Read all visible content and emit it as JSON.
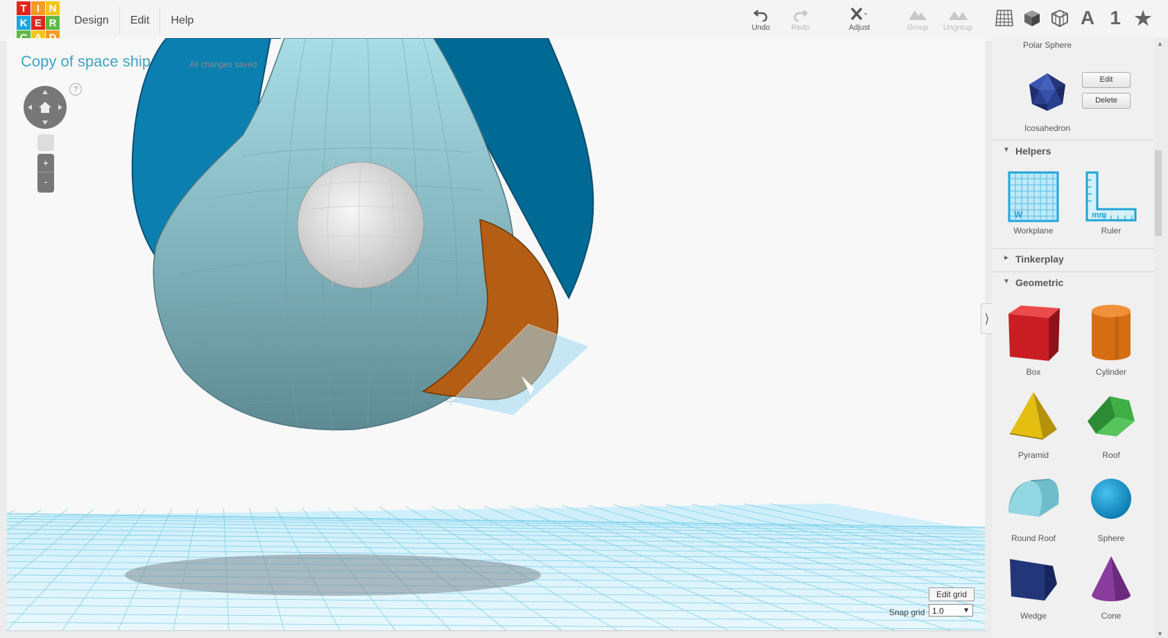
{
  "app": {
    "logo_letters": [
      "T",
      "I",
      "N",
      "K",
      "E",
      "R",
      "C",
      "A",
      "D"
    ],
    "logo_colors": [
      "#e1261c",
      "#f59a23",
      "#f3c51b",
      "#1ca7e0",
      "#e1261c",
      "#5fb846",
      "#5fb846",
      "#f3c51b",
      "#f59a23"
    ]
  },
  "menu": {
    "items": [
      "Design",
      "Edit",
      "Help"
    ]
  },
  "toolbar": {
    "undo": "Undo",
    "redo": "Redo",
    "adjust": "Adjust",
    "group": "Group",
    "ungroup": "Ungroup",
    "number_icon": "1"
  },
  "design": {
    "title": "Copy of space ship",
    "status": "All changes saved",
    "help": "?",
    "zoom_in": "+",
    "zoom_out": "-"
  },
  "grid_controls": {
    "edit_grid": "Edit grid",
    "snap_label": "Snap grid",
    "snap_value": "1.0",
    "snap_arrow": "▼"
  },
  "panel": {
    "top_label": "Polar Sphere",
    "custom_shape": {
      "name": "Icosahedron",
      "edit": "Edit",
      "delete": "Delete"
    },
    "sections": [
      {
        "label": "Helpers",
        "expanded": true
      },
      {
        "label": "Tinkerplay",
        "expanded": false
      },
      {
        "label": "Geometric",
        "expanded": true
      }
    ],
    "helpers": [
      "Workplane",
      "Ruler"
    ],
    "geometric": [
      "Box",
      "Cylinder",
      "Pyramid",
      "Roof",
      "Round Roof",
      "Sphere",
      "Wedge",
      "Cone"
    ]
  },
  "colors": {
    "accent": "#3ea2c6",
    "ship_blue": "#0b7fb0",
    "ship_light": "#7fb7c4",
    "orange": "#b45d15",
    "grid": "#5ac3e4"
  }
}
